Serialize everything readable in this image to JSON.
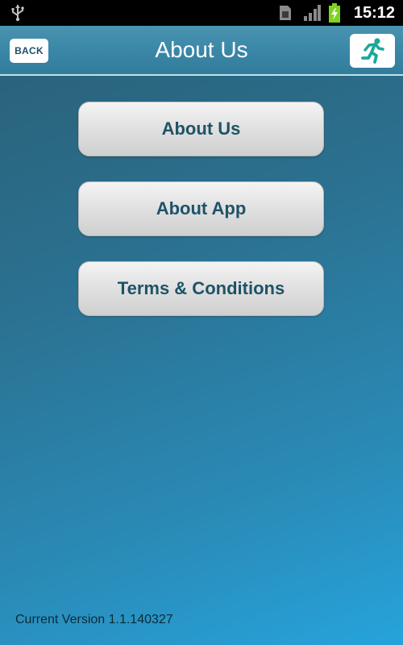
{
  "status_bar": {
    "time": "15:12",
    "icons": [
      "usb-icon",
      "sim-card-icon",
      "signal-icon",
      "battery-charging-icon"
    ]
  },
  "header": {
    "back_label": "BACK",
    "title": "About Us",
    "action_icon": "running-person-icon"
  },
  "menu": {
    "items": [
      {
        "label": "About Us"
      },
      {
        "label": "About App"
      },
      {
        "label": "Terms & Conditions"
      }
    ]
  },
  "footer": {
    "version": "Current Version 1.1.140327"
  },
  "colors": {
    "accent": "#1e5366",
    "header": "#3b87a7",
    "background_start": "#2a5f74",
    "background_end": "#26a3dc",
    "battery": "#7ed321"
  }
}
